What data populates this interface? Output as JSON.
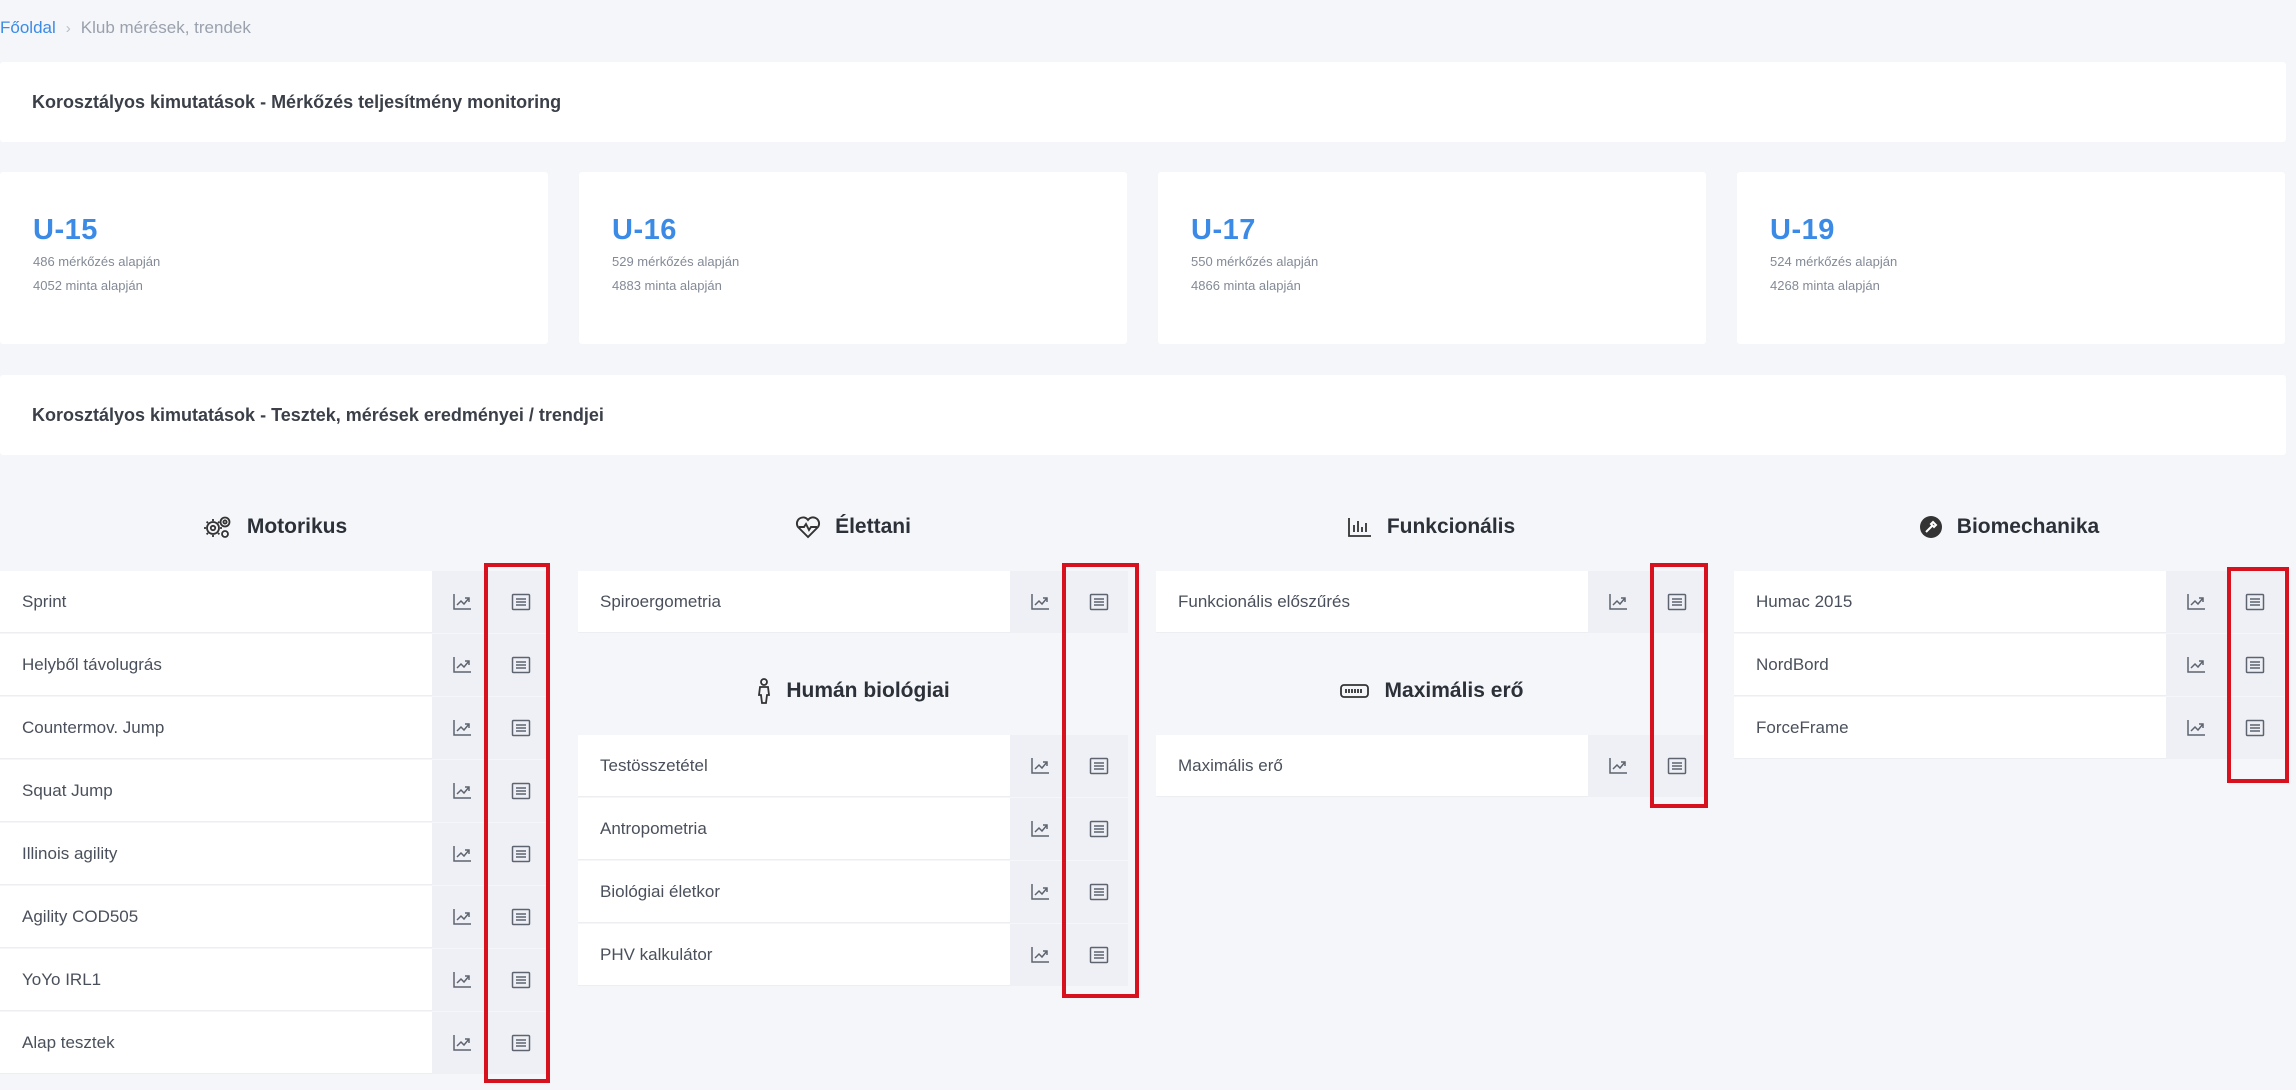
{
  "breadcrumb": {
    "home": "Főoldal",
    "separator": "›",
    "current": "Klub mérések, trendek"
  },
  "sections": {
    "match": "Korosztályos kimutatások - Mérkőzés teljesítmény monitoring",
    "tests": "Korosztályos kimutatások - Tesztek, mérések eredményei / trendjei"
  },
  "age_groups": [
    {
      "title": "U-15",
      "matches": "486 mérkőzés alapján",
      "samples": "4052 minta alapján"
    },
    {
      "title": "U-16",
      "matches": "529 mérkőzés alapján",
      "samples": "4883 minta alapján"
    },
    {
      "title": "U-17",
      "matches": "550 mérkőzés alapján",
      "samples": "4866 minta alapján"
    },
    {
      "title": "U-19",
      "matches": "524 mérkőzés alapján",
      "samples": "4268 minta alapján"
    }
  ],
  "categories": {
    "motorikus": {
      "title": "Motorikus",
      "icon": "gears-icon",
      "items": [
        "Sprint",
        "Helyből távolugrás",
        "Countermov. Jump",
        "Squat Jump",
        "Illinois agility",
        "Agility COD505",
        "YoYo IRL1",
        "Alap tesztek"
      ]
    },
    "elettani": {
      "title": "Élettani",
      "icon": "heartbeat-icon",
      "items": [
        "Spiroergometria"
      ]
    },
    "human": {
      "title": "Humán biológiai",
      "icon": "person-icon",
      "items": [
        "Testösszetétel",
        "Antropometria",
        "Biológiai életkor",
        "PHV kalkulátor"
      ]
    },
    "funkcionalis": {
      "title": "Funkcionális",
      "icon": "bar-chart-icon",
      "items": [
        "Funkcionális előszűrés"
      ]
    },
    "maxero": {
      "title": "Maximális erő",
      "icon": "battery-icon",
      "items": [
        "Maximális erő"
      ]
    },
    "biomechanika": {
      "title": "Biomechanika",
      "icon": "tool-icon",
      "items": [
        "Humac 2015",
        "NordBord",
        "ForceFrame"
      ]
    }
  },
  "colors": {
    "accent": "#3b8be6",
    "highlight": "#d7111d",
    "background": "#f5f6fa"
  }
}
